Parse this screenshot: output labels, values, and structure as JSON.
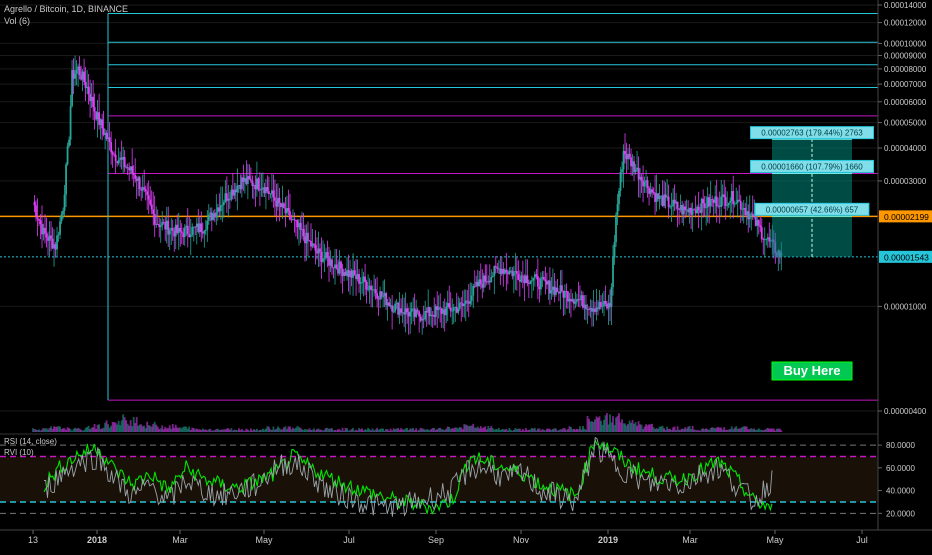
{
  "header": {
    "title": "Agrello / Bitcoin, 1D, BINANCE",
    "volume_label": "Vol (6)"
  },
  "rsi_pane": {
    "rsi_label": "RSI (14, close)",
    "rvi_label": "RVI (10)"
  },
  "buy_label": "Buy Here",
  "colors": {
    "background": "#000000",
    "level_cyan": "#26c6da",
    "level_magenta": "#c217c2",
    "level_orange": "#ff9800",
    "candle_up": "#26a69a",
    "candle_down": "#e040fb",
    "rsi_line": "#00e600",
    "rvi_line": "#9aa4aa",
    "target_box": "#00897b",
    "buy_box": "#00c853"
  },
  "chart_data": [
    {
      "type": "line",
      "title": "Agrello / Bitcoin, 1D, BINANCE",
      "y_axis_ticks": [
        "0.00014000",
        "0.00012000",
        "0.00010000",
        "0.00009000",
        "0.00008000",
        "0.00007000",
        "0.00006000",
        "0.00005000",
        "0.00004000",
        "0.00003000",
        "0.00002199",
        "0.00001543",
        "0.00001000",
        "0.00000400"
      ],
      "x_axis_ticks": [
        "13",
        "2018",
        "Mar",
        "May",
        "Jul",
        "Sep",
        "Nov",
        "2019",
        "Mar",
        "May",
        "Jul"
      ],
      "ylim": [
        3.5e-06,
        0.000145
      ],
      "y_scale": "log",
      "price_series": {
        "name": "",
        "x": [
          "2017-12-13",
          "2017-12-20",
          "2017-12-28",
          "2018-01-02",
          "2018-01-06",
          "2018-01-08",
          "2018-01-12",
          "2018-01-18",
          "2018-01-25",
          "2018-02-05",
          "2018-02-20",
          "2018-03-05",
          "2018-03-20",
          "2018-04-05",
          "2018-04-20",
          "2018-05-01",
          "2018-05-15",
          "2018-06-01",
          "2018-06-20",
          "2018-07-05",
          "2018-07-25",
          "2018-08-10",
          "2018-08-25",
          "2018-09-10",
          "2018-09-25",
          "2018-10-05",
          "2018-10-20",
          "2018-11-05",
          "2018-11-20",
          "2018-12-05",
          "2018-12-20",
          "2019-01-01",
          "2019-01-05",
          "2019-01-10",
          "2019-01-20",
          "2019-02-01",
          "2019-02-20",
          "2019-03-10",
          "2019-03-25",
          "2019-04-05",
          "2019-04-15",
          "2019-04-25"
        ],
        "values": [
          2.5e-05,
          1.9e-05,
          1.7e-05,
          2.4e-05,
          4.5e-05,
          7.5e-05,
          8e-05,
          6.8e-05,
          5.2e-05,
          3.8e-05,
          3.1e-05,
          2.1e-05,
          1.9e-05,
          2e-05,
          2.6e-05,
          3e-05,
          2.9e-05,
          2.2e-05,
          1.6e-05,
          1.4e-05,
          1.2e-05,
          1e-05,
          9.2e-06,
          9.6e-06,
          1e-05,
          1.2e-05,
          1.4e-05,
          1.3e-05,
          1.2e-05,
          1.1e-05,
          1e-05,
          1e-05,
          2.2e-05,
          3.9e-05,
          3.2e-05,
          2.6e-05,
          2.3e-05,
          2.5e-05,
          2.6e-05,
          2.2e-05,
          1.8e-05,
          1.55e-05
        ]
      },
      "volume_series": {
        "name": "Vol (6)",
        "values": [
          2,
          3,
          2,
          4,
          6,
          9,
          5,
          4,
          3,
          2,
          2,
          2,
          2,
          3,
          3,
          2,
          2,
          2,
          2,
          2,
          2,
          2,
          2,
          3,
          4,
          3,
          2,
          2,
          2,
          2,
          3,
          8,
          10,
          6,
          4,
          3,
          3,
          2,
          3,
          3,
          2,
          2
        ]
      },
      "horizontal_levels": [
        {
          "value": 0.00013,
          "color": "cyan"
        },
        {
          "value": 0.000101,
          "color": "cyan"
        },
        {
          "value": 8.3e-05,
          "color": "cyan"
        },
        {
          "value": 6.8e-05,
          "color": "cyan"
        },
        {
          "value": 5.3e-05,
          "color": "magenta"
        },
        {
          "value": 3.2e-05,
          "color": "magenta"
        },
        {
          "value": 2.199e-05,
          "color": "orange"
        },
        {
          "value": 1.543e-05,
          "color": "cyan dotted"
        },
        {
          "value": 4.4e-06,
          "color": "magenta"
        }
      ],
      "targets": [
        {
          "label": "0.00002763 (179.44%) 2763"
        },
        {
          "label": "0.00001660 (107.79%) 1660"
        },
        {
          "label": "0.00000657 (42.66%) 657"
        }
      ],
      "price_labels": [
        {
          "text": "0.00002199",
          "color": "orange"
        },
        {
          "text": "0.00001543",
          "color": "cyan"
        }
      ]
    },
    {
      "type": "line",
      "title": "",
      "y_axis_ticks": [
        "80.0000",
        "60.0000",
        "40.0000",
        "20.0000"
      ],
      "ylim": [
        15,
        88
      ],
      "levels": [
        80,
        70,
        30,
        20
      ],
      "series": [
        {
          "name": "RSI (14, close)",
          "values": [
            45,
            62,
            72,
            78,
            58,
            45,
            55,
            40,
            60,
            50,
            45,
            42,
            48,
            55,
            70,
            60,
            52,
            45,
            40,
            35,
            30,
            28,
            25,
            32,
            70,
            65,
            60,
            55,
            45,
            40,
            35,
            85,
            75,
            62,
            55,
            50,
            50,
            58,
            65,
            50,
            30,
            25
          ]
        },
        {
          "name": "RVI (10)",
          "values": [
            40,
            55,
            65,
            70,
            50,
            35,
            45,
            30,
            50,
            40,
            35,
            40,
            45,
            60,
            65,
            55,
            40,
            35,
            30,
            25,
            25,
            30,
            35,
            40,
            60,
            60,
            50,
            55,
            40,
            35,
            30,
            80,
            65,
            55,
            45,
            48,
            45,
            55,
            60,
            45,
            30,
            50
          ]
        }
      ]
    }
  ]
}
